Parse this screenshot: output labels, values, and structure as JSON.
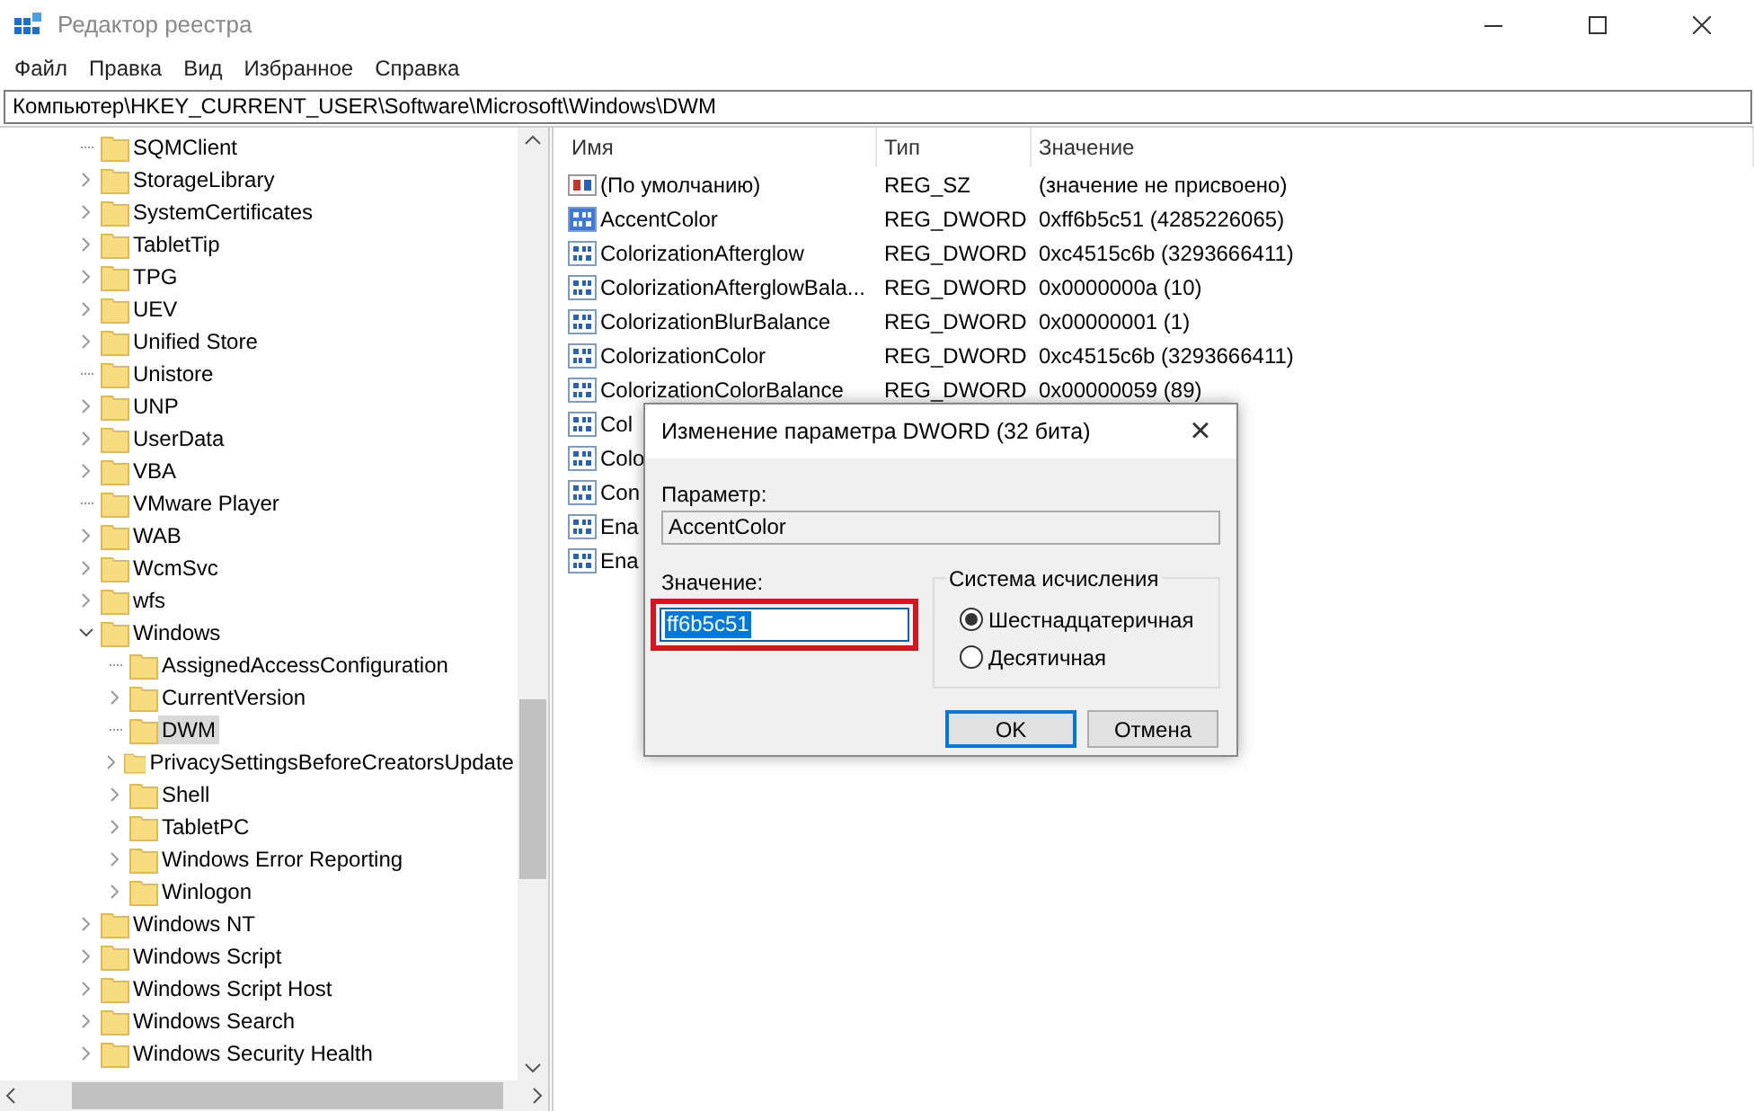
{
  "window": {
    "title": "Редактор реестра"
  },
  "menu": [
    "Файл",
    "Правка",
    "Вид",
    "Избранное",
    "Справка"
  ],
  "address": "Компьютер\\HKEY_CURRENT_USER\\Software\\Microsoft\\Windows\\DWM",
  "tree": [
    {
      "label": "SQMClient",
      "expandable": false,
      "expanded": false,
      "selected": false
    },
    {
      "label": "StorageLibrary",
      "expandable": true,
      "expanded": false,
      "selected": false
    },
    {
      "label": "SystemCertificates",
      "expandable": true,
      "expanded": false,
      "selected": false
    },
    {
      "label": "TabletTip",
      "expandable": true,
      "expanded": false,
      "selected": false
    },
    {
      "label": "TPG",
      "expandable": true,
      "expanded": false,
      "selected": false
    },
    {
      "label": "UEV",
      "expandable": true,
      "expanded": false,
      "selected": false
    },
    {
      "label": "Unified Store",
      "expandable": true,
      "expanded": false,
      "selected": false
    },
    {
      "label": "Unistore",
      "expandable": false,
      "expanded": false,
      "selected": false
    },
    {
      "label": "UNP",
      "expandable": true,
      "expanded": false,
      "selected": false
    },
    {
      "label": "UserData",
      "expandable": true,
      "expanded": false,
      "selected": false
    },
    {
      "label": "VBA",
      "expandable": true,
      "expanded": false,
      "selected": false
    },
    {
      "label": "VMware Player",
      "expandable": false,
      "expanded": false,
      "selected": false
    },
    {
      "label": "WAB",
      "expandable": true,
      "expanded": false,
      "selected": false
    },
    {
      "label": "WcmSvc",
      "expandable": true,
      "expanded": false,
      "selected": false
    },
    {
      "label": "wfs",
      "expandable": true,
      "expanded": false,
      "selected": false
    },
    {
      "label": "Windows",
      "expandable": true,
      "expanded": true,
      "selected": false,
      "children": [
        {
          "label": "AssignedAccessConfiguration",
          "expandable": false,
          "expanded": false,
          "selected": false
        },
        {
          "label": "CurrentVersion",
          "expandable": true,
          "expanded": false,
          "selected": false
        },
        {
          "label": "DWM",
          "expandable": false,
          "expanded": false,
          "selected": true
        },
        {
          "label": "PrivacySettingsBeforeCreatorsUpdate",
          "expandable": true,
          "expanded": false,
          "selected": false
        },
        {
          "label": "Shell",
          "expandable": true,
          "expanded": false,
          "selected": false
        },
        {
          "label": "TabletPC",
          "expandable": true,
          "expanded": false,
          "selected": false
        },
        {
          "label": "Windows Error Reporting",
          "expandable": true,
          "expanded": false,
          "selected": false
        },
        {
          "label": "Winlogon",
          "expandable": true,
          "expanded": false,
          "selected": false
        }
      ]
    },
    {
      "label": "Windows NT",
      "expandable": true,
      "expanded": false,
      "selected": false
    },
    {
      "label": "Windows Script",
      "expandable": true,
      "expanded": false,
      "selected": false
    },
    {
      "label": "Windows Script Host",
      "expandable": true,
      "expanded": false,
      "selected": false
    },
    {
      "label": "Windows Search",
      "expandable": true,
      "expanded": false,
      "selected": false
    },
    {
      "label": "Windows Security Health",
      "expandable": true,
      "expanded": false,
      "selected": false
    }
  ],
  "table": {
    "columns": [
      "Имя",
      "Тип",
      "Значение"
    ],
    "rows": [
      {
        "kind": "string",
        "selected": false,
        "name": "(По умолчанию)",
        "type": "REG_SZ",
        "value": "(значение не присвоено)"
      },
      {
        "kind": "dword",
        "selected": true,
        "name": "AccentColor",
        "type": "REG_DWORD",
        "value": "0xff6b5c51 (4285226065)"
      },
      {
        "kind": "dword",
        "selected": false,
        "name": "ColorizationAfterglow",
        "type": "REG_DWORD",
        "value": "0xc4515c6b (3293666411)"
      },
      {
        "kind": "dword",
        "selected": false,
        "name": "ColorizationAfterglowBala...",
        "type": "REG_DWORD",
        "value": "0x0000000a (10)"
      },
      {
        "kind": "dword",
        "selected": false,
        "name": "ColorizationBlurBalance",
        "type": "REG_DWORD",
        "value": "0x00000001 (1)"
      },
      {
        "kind": "dword",
        "selected": false,
        "name": "ColorizationColor",
        "type": "REG_DWORD",
        "value": "0xc4515c6b (3293666411)"
      },
      {
        "kind": "dword",
        "selected": false,
        "name": "ColorizationColorBalance",
        "type": "REG_DWORD",
        "value": "0x00000059 (89)"
      },
      {
        "kind": "dword",
        "selected": false,
        "name": "Col"
      },
      {
        "kind": "dword",
        "selected": false,
        "name": "Colo"
      },
      {
        "kind": "dword",
        "selected": false,
        "name": "Con"
      },
      {
        "kind": "dword",
        "selected": false,
        "name": "Ena"
      },
      {
        "kind": "dword",
        "selected": false,
        "name": "Ena"
      }
    ]
  },
  "dialog": {
    "title": "Изменение параметра DWORD (32 бита)",
    "close": "×",
    "param_label": "Параметр:",
    "param_value": "AccentColor",
    "value_label": "Значение:",
    "value": "ff6b5c51",
    "base_group": "Система исчисления",
    "bases": [
      {
        "label": "Шестнадцатеричная",
        "selected": true
      },
      {
        "label": "Десятичная",
        "selected": false
      }
    ],
    "buttons": [
      {
        "label": "OK",
        "default": true
      },
      {
        "label": "Отмена",
        "default": false
      }
    ]
  }
}
